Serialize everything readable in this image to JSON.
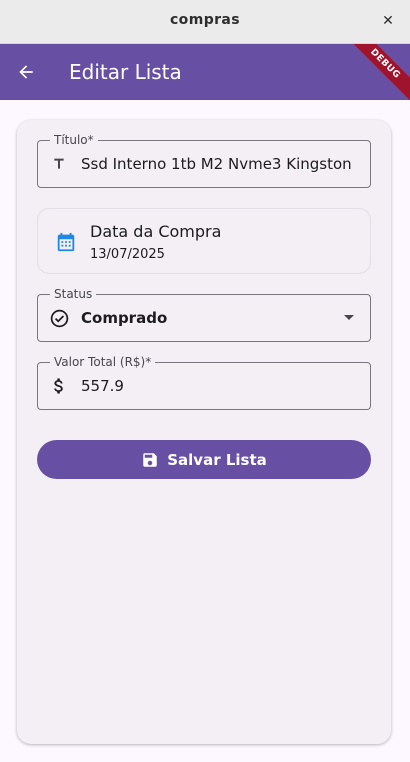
{
  "window": {
    "title": "compras",
    "close_glyph": "✕"
  },
  "appbar": {
    "title": "Editar Lista",
    "debug_label": "DEBUG",
    "back_icon": "arrow-left-icon"
  },
  "form": {
    "titulo": {
      "label": "Título*",
      "value": "Ssd Interno 1tb M2 Nvme3 Kingston",
      "icon": "title-t-icon"
    },
    "date": {
      "title": "Data da Compra",
      "value": "13/07/2025",
      "icon": "calendar-icon"
    },
    "status": {
      "label": "Status",
      "value": "Comprado",
      "icon": "check-circle-icon"
    },
    "valor": {
      "label": "Valor Total (R$)*",
      "value": "557.9",
      "icon": "dollar-icon"
    },
    "save_label": "Salvar Lista"
  },
  "colors": {
    "primary": "#6750a4",
    "accent_blue": "#1e88e5",
    "debug_red": "#a0132c"
  }
}
